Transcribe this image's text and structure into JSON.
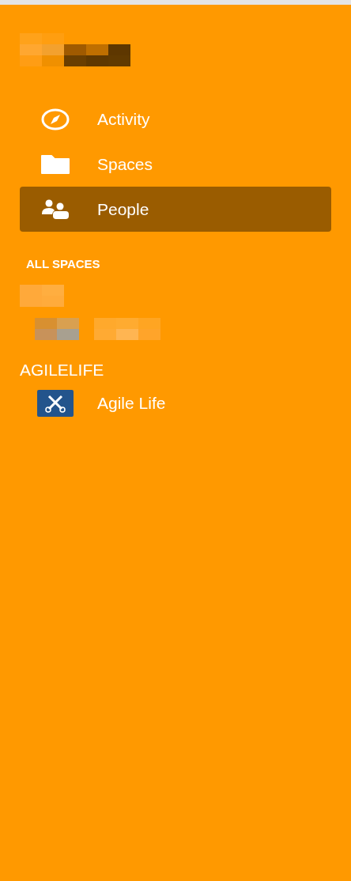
{
  "nav": [
    {
      "label": "Activity",
      "kind": "compass",
      "selected": false
    },
    {
      "label": "Spaces",
      "kind": "folder",
      "selected": false
    },
    {
      "label": "People",
      "kind": "people",
      "selected": true
    }
  ],
  "section_title": "ALL SPACES",
  "space_groups": [
    {
      "title": "AGILELIFE",
      "spaces": [
        {
          "name": "Agile Life"
        }
      ]
    }
  ]
}
